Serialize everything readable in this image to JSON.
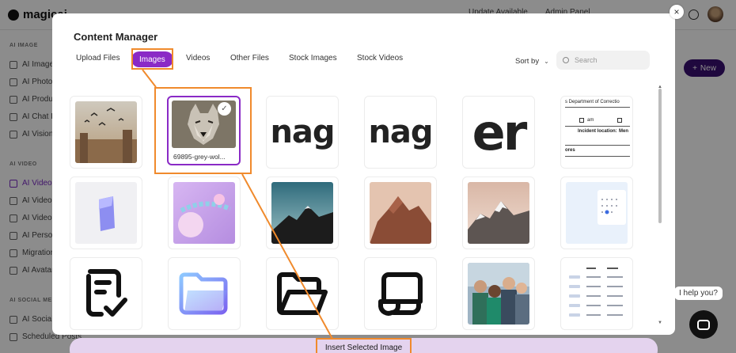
{
  "background": {
    "logo_text": "magicai",
    "topbar_items": [
      "Update Available",
      "Admin Panel"
    ],
    "new_button": "New",
    "help_text": "I help you?",
    "sidebar_sections": [
      {
        "label": "AI IMAGE",
        "items": [
          "AI Image",
          "AI Photo",
          "AI Produ",
          "AI Chat Ir",
          "AI Vision"
        ]
      },
      {
        "label": "AI VIDEO",
        "items": [
          "AI Video",
          "AI Video",
          "AI Video",
          "AI Persor",
          "Migration",
          "AI Avatar"
        ]
      },
      {
        "label": "AI SOCIAL MED",
        "items": [
          "AI Social",
          "Scheduled Posts"
        ]
      }
    ]
  },
  "modal": {
    "title": "Content Manager",
    "tabs": [
      {
        "label": "Upload Files",
        "active": false
      },
      {
        "label": "Images",
        "active": true
      },
      {
        "label": "Videos",
        "active": false
      },
      {
        "label": "Other Files",
        "active": false
      },
      {
        "label": "Stock Images",
        "active": false
      },
      {
        "label": "Stock Videos",
        "active": false
      }
    ],
    "sort_label": "Sort by",
    "search_placeholder": "Search",
    "selected_caption": "69895-grey-wol...",
    "insert_button": "Insert Selected Image",
    "close_symbol": "×",
    "tiles": {
      "word_mag": "nag",
      "word_er": "er",
      "doc_header": "s Department of Correctio",
      "doc_am": "am",
      "doc_location": "Incident location:",
      "doc_men": "Men",
      "doc_footer": "ores"
    }
  },
  "colors": {
    "accent": "#8a2ac6",
    "annotation": "#f08a2c",
    "new_button": "#3a0f72"
  }
}
